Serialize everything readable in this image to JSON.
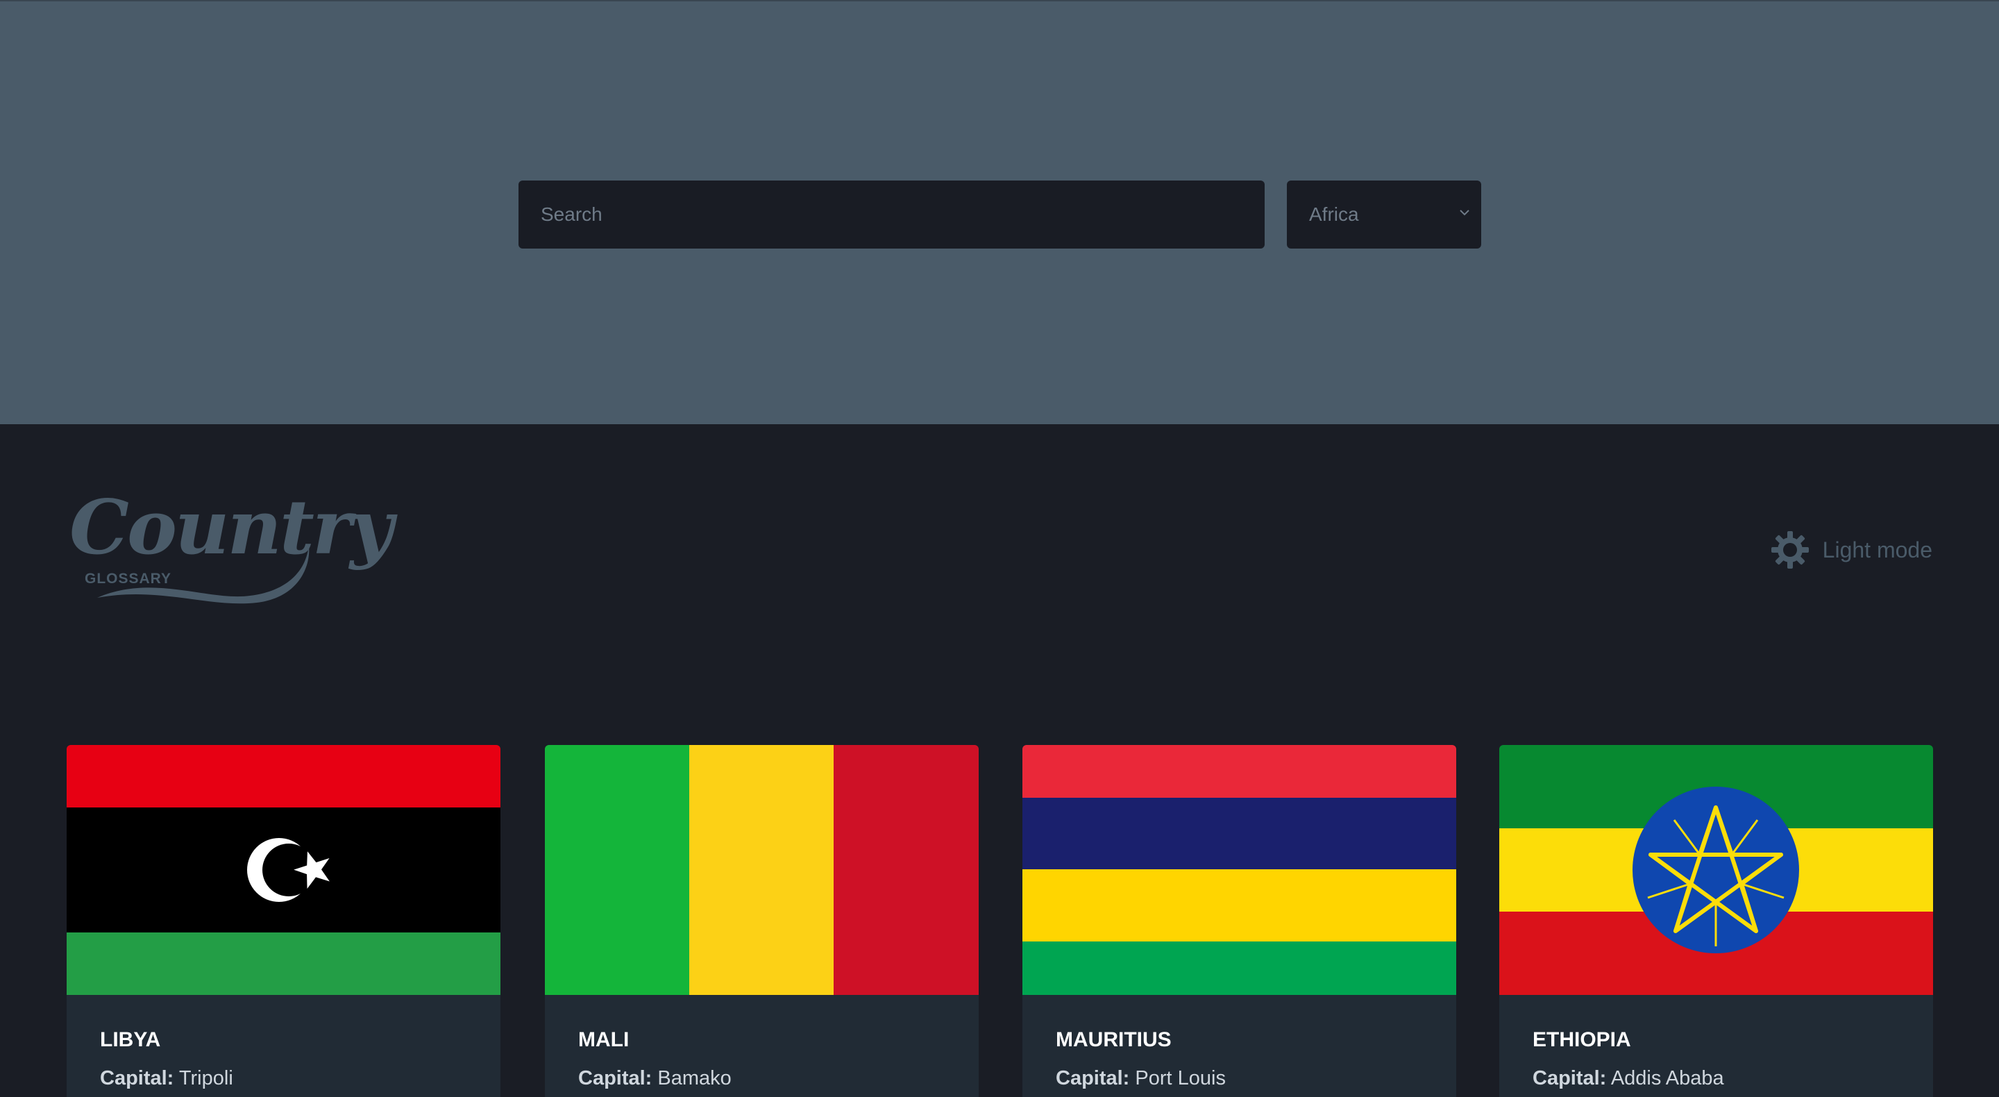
{
  "search": {
    "placeholder": "Search",
    "value": ""
  },
  "region_filter": {
    "selected": "Africa"
  },
  "logo": {
    "title": "Country",
    "subtitle": "GLOSSARY"
  },
  "theme_toggle": {
    "label": "Light mode",
    "icon": "gear-icon"
  },
  "countries": [
    {
      "name": "LIBYA",
      "capital_label": "Capital:",
      "capital": "Tripoli"
    },
    {
      "name": "MALI",
      "capital_label": "Capital:",
      "capital": "Bamako"
    },
    {
      "name": "MAURITIUS",
      "capital_label": "Capital:",
      "capital": "Port Louis"
    },
    {
      "name": "ETHIOPIA",
      "capital_label": "Capital:",
      "capital": "Addis Ababa"
    }
  ],
  "colors": {
    "header_band": "#4a5b69",
    "page_background": "#1a1d25",
    "card_background": "#212b35",
    "input_background": "#191c24"
  }
}
